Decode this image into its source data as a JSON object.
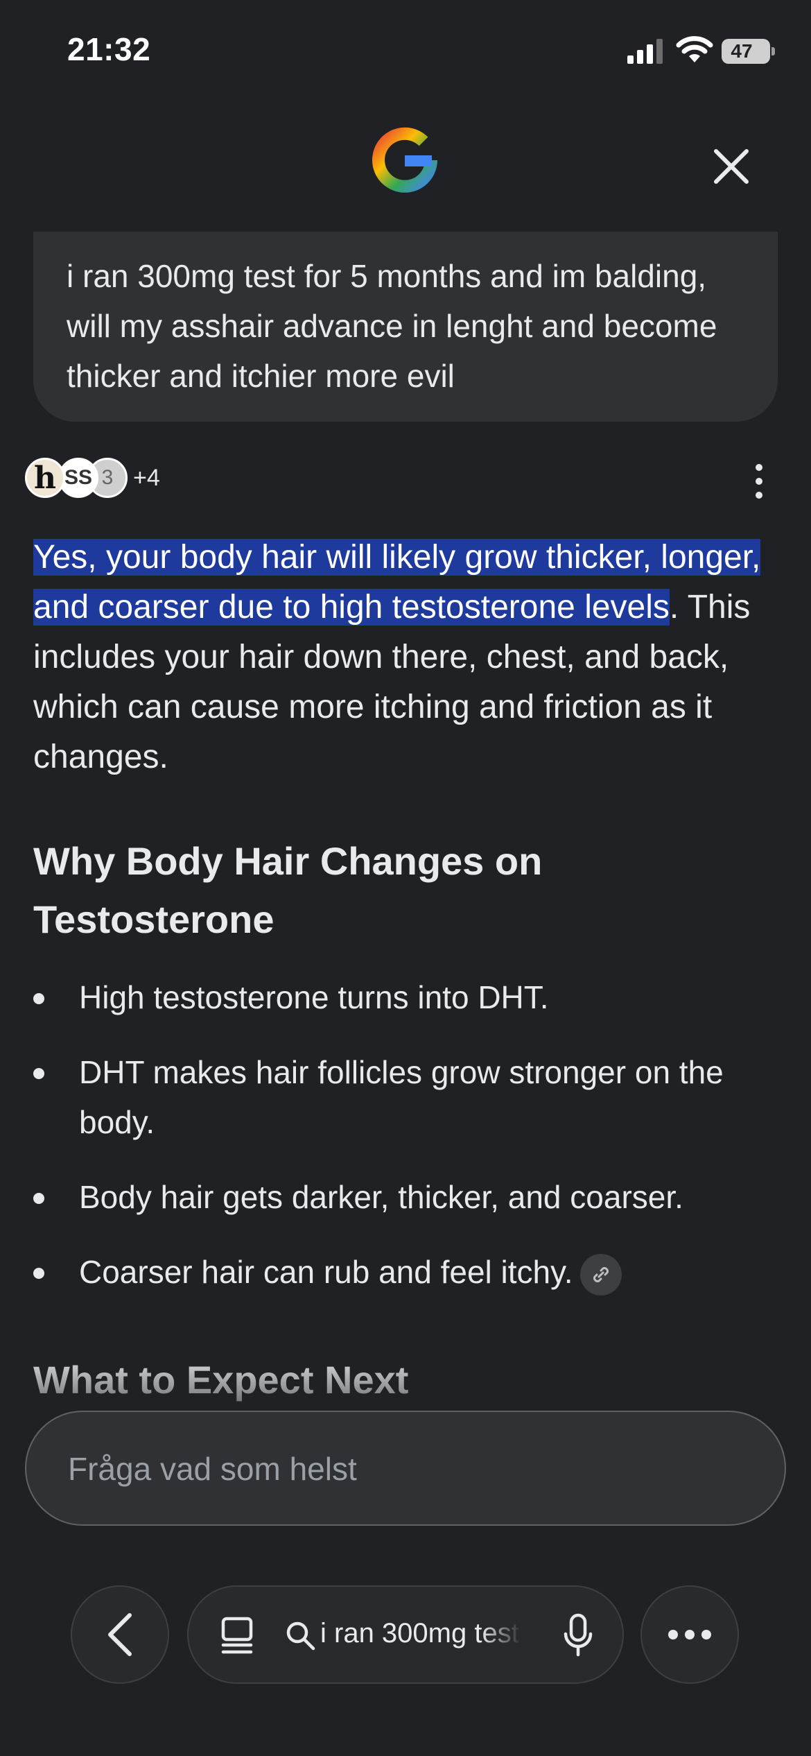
{
  "status": {
    "time": "21:32",
    "battery": "47"
  },
  "query": {
    "text": "i ran 300mg test for 5 months and im balding, will my asshair advance in lenght and become thicker and itchier more evil"
  },
  "sources": {
    "icon_letters": [
      "h",
      "SS",
      "3"
    ],
    "more_count": "+4"
  },
  "answer": {
    "highlighted": "Yes, your body hair will likely grow thicker, longer, and coarser due to high testosterone levels",
    "rest": ". This includes your hair down there, chest, and back, which can cause more itching and friction as it changes."
  },
  "section": {
    "title": "Why Body Hair Changes on Testosterone",
    "bullets": [
      "High testosterone turns into DHT.",
      "DHT makes hair follicles grow stronger on the body.",
      "Body hair gets darker, thicker, and coarser.",
      "Coarser hair can rub and feel itchy."
    ]
  },
  "next_section_title": "What to Expect Next",
  "ask": {
    "placeholder": "Fråga vad som helst",
    "value": ""
  },
  "toolbar": {
    "url_text": "i ran 300mg test"
  },
  "colors": {
    "background": "#202124",
    "highlight": "#1e3a9c",
    "surface": "#303134"
  },
  "icons": [
    "google-logo-icon",
    "close-icon",
    "kebab-menu-icon",
    "link-icon",
    "back-chevron-icon",
    "tabs-icon",
    "search-icon",
    "microphone-icon",
    "more-icon"
  ]
}
